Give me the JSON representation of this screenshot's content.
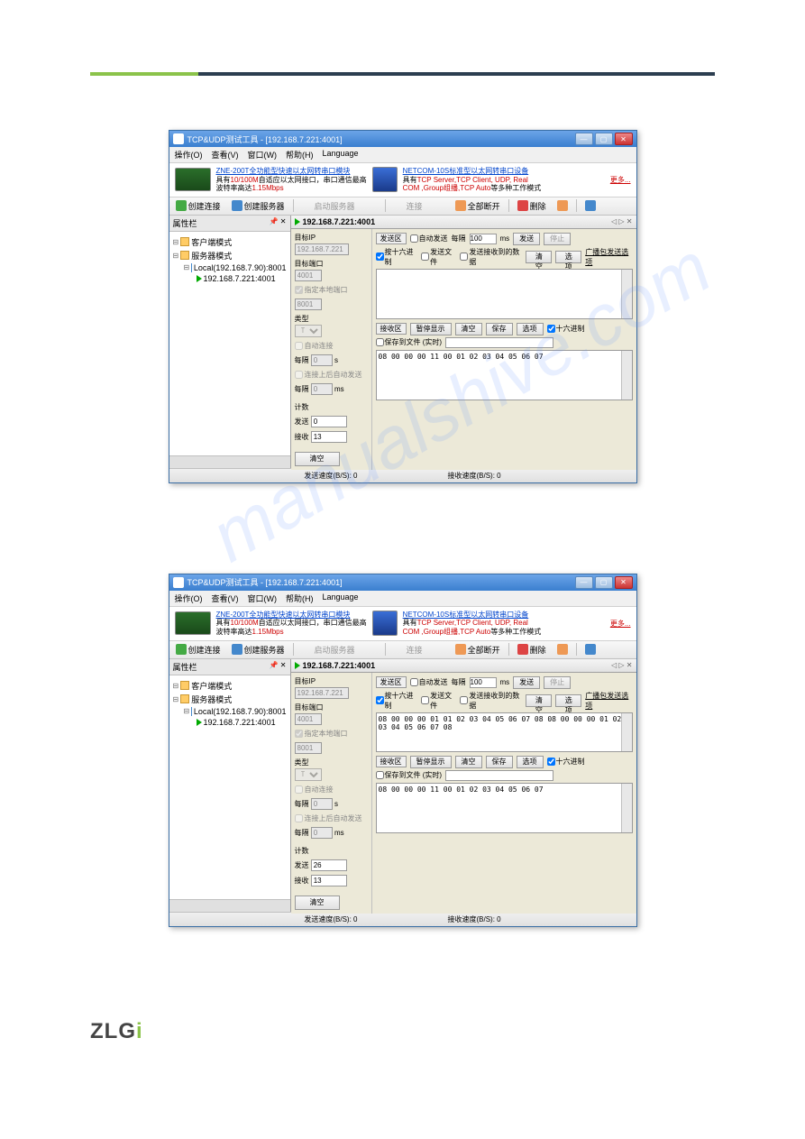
{
  "watermark": "manualshive.com",
  "logo": "ZLG",
  "win1": {
    "title": "TCP&UDP测试工具 - [192.168.7.221:4001]",
    "menu": [
      "操作(O)",
      "查看(V)",
      "窗口(W)",
      "帮助(H)",
      "Language"
    ],
    "banner_left_link": "ZNE-200T全功能型快速以太网转串口模块",
    "banner_left_line2a": "具有",
    "banner_left_line2b": "10/100M",
    "banner_left_line2c": "自适应以太网接口，串口通信最高",
    "banner_left_line3a": "波特率高达",
    "banner_left_line3b": "1.15Mbps",
    "banner_right_link": "NETCOM-10S标准型以太网转串口设备",
    "banner_right_line2a": "具有",
    "banner_right_line2b": "TCP Server,TCP Client, UDP, Real",
    "banner_right_line3a": "COM ,Group组播,",
    "banner_right_line3b": "TCP Auto",
    "banner_right_line3c": "等多种工作模式",
    "more": "更多...",
    "toolbar": {
      "t1": "创建连接",
      "t2": "创建服务器",
      "t3": "启动服务器",
      "t4": "⊙",
      "t5": "连接",
      "t6": "⊗",
      "t7": "全部断开",
      "t8": "删除",
      "t9": "⊘",
      "t10": "⊡"
    },
    "sidebar_title": "属性栏",
    "tree": {
      "client": "客户端模式",
      "server": "服务器模式",
      "local": "Local(192.168.7.90):8001",
      "conn": "192.168.7.221:4001"
    },
    "tab": "192.168.7.221:4001",
    "params": {
      "ip_label": "目标IP",
      "ip": "192.168.7.221",
      "port_label": "目标端口",
      "port": "4001",
      "bind_chk": "指定本地端口",
      "bind_port": "8001",
      "type_label": "类型",
      "type": "TCP",
      "auto_chk": "自动连接",
      "interval_label": "每隔",
      "interval": "0",
      "unit_s": "s",
      "auto_send_chk": "连接上后自动发送",
      "interval2": "0",
      "unit_ms": "ms",
      "counter": "计数",
      "send_label": "发送",
      "send_count": "0",
      "recv_label": "接收",
      "recv_count": "13",
      "clear": "清空"
    },
    "send_area": {
      "label": "发送区",
      "auto": "自动发送",
      "each": "每隔",
      "interval": "100",
      "ms": "ms",
      "send_btn": "发送",
      "stop_btn": "停止",
      "hex": "按十六进制",
      "file": "发送文件",
      "recv_on_send": "发送接收到的数据",
      "clear": "清空",
      "opts": "选项",
      "broadcast": "广播包发送选项"
    },
    "recv_area": {
      "label": "接收区",
      "pause": "暂停显示",
      "clear": "清空",
      "save": "保存",
      "opts": "选项",
      "hex": "十六进制",
      "save_file": "保存到文件 (实时)",
      "data": "08 00 00 00 11 00 01 02 03 04 05 06 07"
    },
    "status": {
      "send": "发送速度(B/S): 0",
      "recv": "接收速度(B/S): 0"
    }
  },
  "win2": {
    "title": "TCP&UDP测试工具 - [192.168.7.221:4001]",
    "toolbar": {
      "t7": "全部断开"
    },
    "tab": "192.168.7.221:4001",
    "params": {
      "ip": "192.168.7.221",
      "port": "4001",
      "bind_port": "8001",
      "send_count": "26",
      "recv_count": "13"
    },
    "send_area": {
      "interval": "100",
      "data": "08 00 00 00 01 01 02 03 04 05 06 07 08 08 00 00 00 01 02 03 04 05 06 07 08"
    },
    "recv_area": {
      "data": "08 00 00 00 11 00 01 02 03 04 05 06 07"
    },
    "status": {
      "send": "发送速度(B/S): 0",
      "recv": "接收速度(B/S): 0"
    }
  }
}
